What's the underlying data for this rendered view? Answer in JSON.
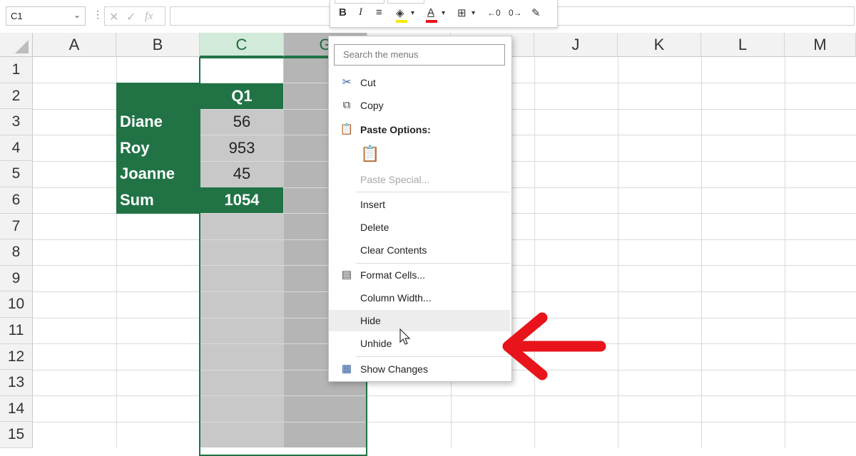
{
  "name_box": {
    "value": "C1"
  },
  "formula_bar": {
    "fx": "fx",
    "value": ""
  },
  "mini_toolbar": {
    "bold": "B",
    "italic": "I",
    "font_color_letter": "A"
  },
  "columns": [
    "A",
    "B",
    "C",
    "G",
    "",
    "J",
    "K",
    "L",
    "M"
  ],
  "rows": [
    "1",
    "2",
    "3",
    "4",
    "5",
    "6",
    "7",
    "8",
    "9",
    "10",
    "11",
    "12",
    "13",
    "14",
    "15"
  ],
  "table": {
    "header": "Q1",
    "names": [
      "Diane",
      "Roy",
      "Joanne",
      "Sum"
    ],
    "values": [
      "56",
      "953",
      "45",
      "1054"
    ]
  },
  "context_menu": {
    "search_placeholder": "Search the menus",
    "items": {
      "cut": "Cut",
      "copy": "Copy",
      "paste_options": "Paste Options:",
      "paste_special": "Paste Special...",
      "insert": "Insert",
      "delete": "Delete",
      "clear_contents": "Clear Contents",
      "format_cells": "Format Cells...",
      "column_width": "Column Width...",
      "hide": "Hide",
      "unhide": "Unhide",
      "show_changes": "Show Changes"
    }
  },
  "colors": {
    "table_green": "#217346",
    "selected_header": "#d2ead9",
    "arrow_red": "#e8131b"
  }
}
